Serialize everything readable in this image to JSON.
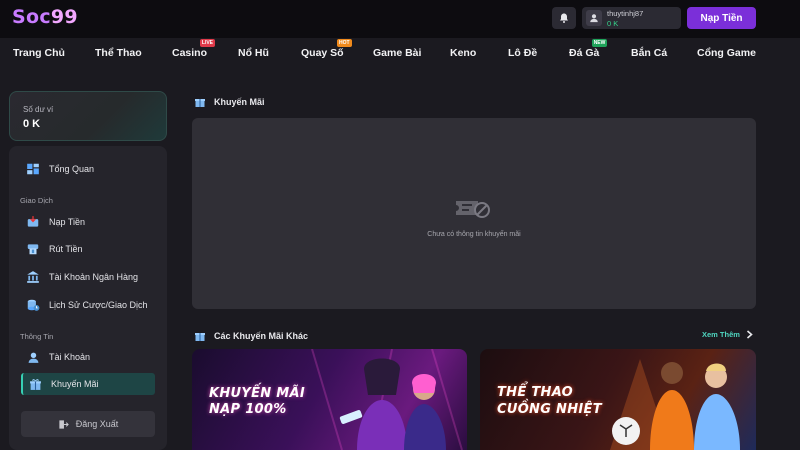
{
  "header": {
    "logo_part1": "Soc",
    "logo_part2": "99",
    "username": "thuytinhj87",
    "balance": "0 K",
    "deposit_label": "Nạp Tiền"
  },
  "nav": {
    "items": [
      {
        "label": "Trang Chủ"
      },
      {
        "label": "Thể Thao"
      },
      {
        "label": "Casino",
        "badge": "LIVE"
      },
      {
        "label": "Nổ Hũ"
      },
      {
        "label": "Quay Số",
        "badge": "HOT"
      },
      {
        "label": "Game Bài"
      },
      {
        "label": "Keno"
      },
      {
        "label": "Lô Đề"
      },
      {
        "label": "Đá Gà",
        "badge": "NEW"
      },
      {
        "label": "Bắn Cá"
      },
      {
        "label": "Cổng Game"
      }
    ]
  },
  "wallet": {
    "label": "Số dư ví",
    "value": "0 K"
  },
  "sidebar": {
    "overview": "Tổng Quan",
    "section_transactions": "Giao Dịch",
    "transactions": [
      "Nạp Tiền",
      "Rút Tiền",
      "Tài Khoản Ngân Hàng",
      "Lịch Sử Cược/Giao Dịch"
    ],
    "section_info": "Thông Tin",
    "info": [
      "Tài Khoản",
      "Khuyến Mãi"
    ],
    "active_item": "Khuyến Mãi",
    "logout": "Đăng Xuất"
  },
  "main": {
    "promo_title": "Khuyến Mãi",
    "empty_text": "Chưa có thông tin khuyến mãi",
    "other_title": "Các Khuyến Mãi Khác",
    "see_more": "Xem Thêm",
    "banners": [
      {
        "line1": "KHUYẾN MÃI",
        "line2": "NẠP 100%"
      },
      {
        "line1": "THỂ THAO",
        "line2": "CUỒNG NHIỆT"
      }
    ]
  },
  "colors": {
    "accent_purple": "#7b2fd9",
    "accent_teal": "#37d0b4",
    "badge_live": "#e03a4a",
    "badge_hot": "#f08a1c",
    "badge_new": "#1fa35a"
  }
}
